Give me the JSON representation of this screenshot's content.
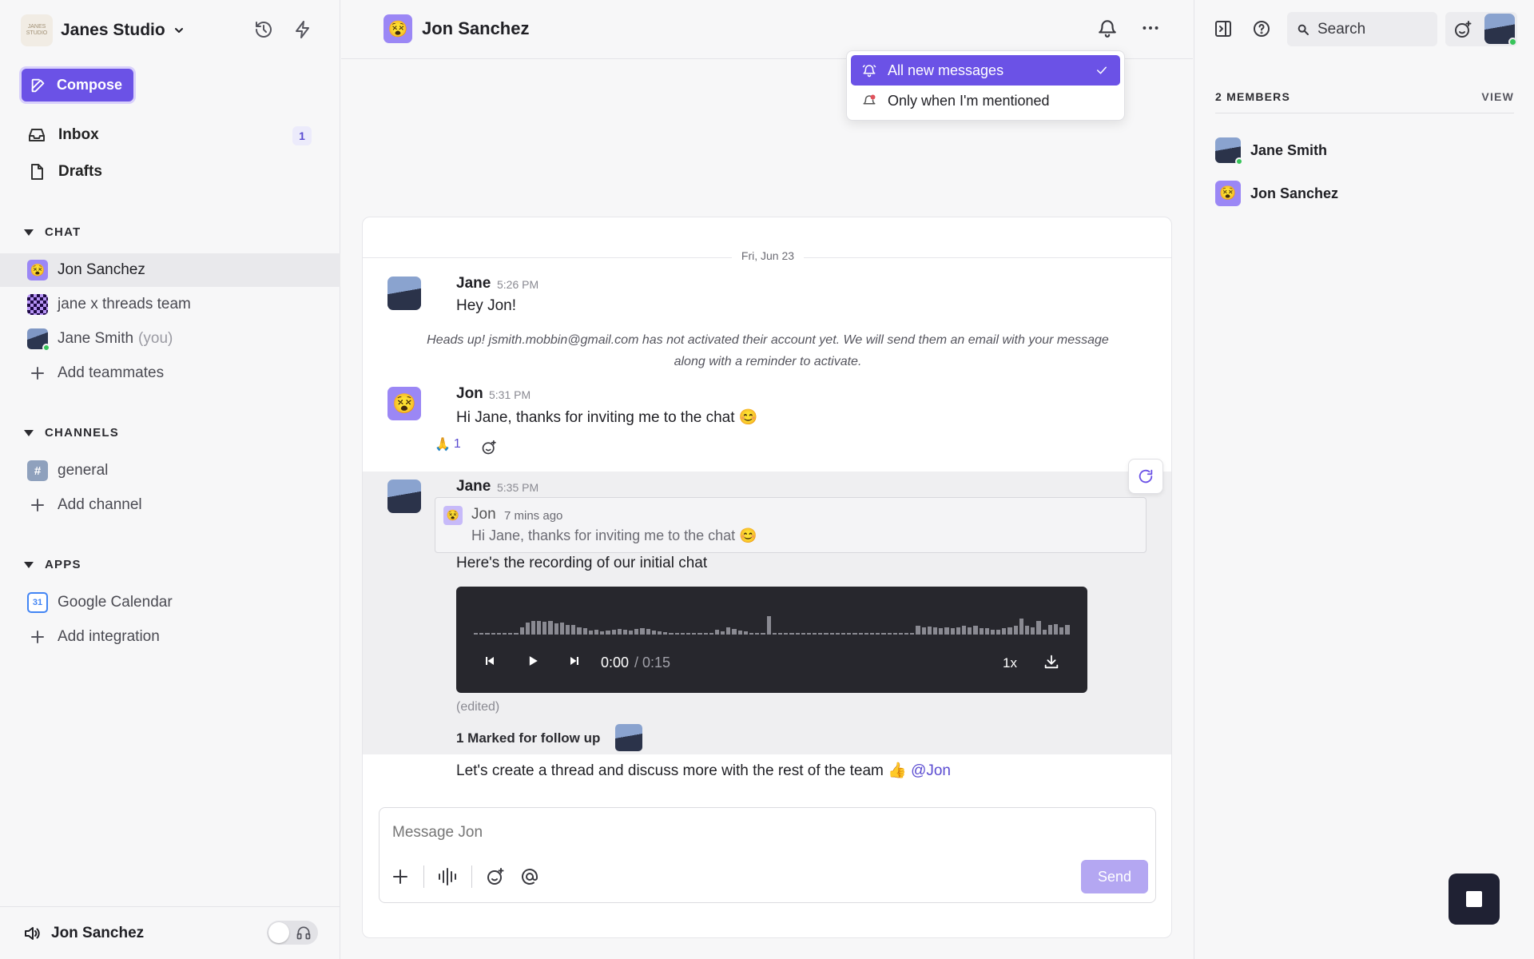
{
  "sidebar": {
    "workspace_name": "Janes Studio",
    "logo_text": "JANES STUDIO",
    "compose_label": "Compose",
    "inbox_label": "Inbox",
    "inbox_count": "1",
    "drafts_label": "Drafts",
    "chat_section": "CHAT",
    "chats": [
      {
        "label": "Jon Sanchez",
        "suffix": ""
      },
      {
        "label": "jane x threads team",
        "suffix": ""
      },
      {
        "label": "Jane Smith",
        "suffix": "(you)"
      }
    ],
    "add_teammates": "Add teammates",
    "channels_section": "CHANNELS",
    "channel_general": "general",
    "add_channel": "Add channel",
    "apps_section": "APPS",
    "app_calendar": "Google Calendar",
    "calendar_day": "31",
    "add_integration": "Add integration",
    "footer_user": "Jon Sanchez"
  },
  "header": {
    "title": "Jon Sanchez"
  },
  "notify_menu": {
    "items": [
      {
        "label": "All new messages",
        "selected": true
      },
      {
        "label": "Only when I'm mentioned",
        "selected": false
      }
    ]
  },
  "conversation": {
    "date": "Fri, Jun 23",
    "msg1": {
      "author": "Jane",
      "time": "5:26 PM",
      "text": "Hey Jon!"
    },
    "notice_line1": "Heads up! jsmith.mobbin@gmail.com has not activated their account yet. We will send them an email with your message",
    "notice_line2": "along with a reminder to activate.",
    "msg2": {
      "author": "Jon",
      "time": "5:31 PM",
      "text": "Hi Jane, thanks for inviting me to the chat 😊"
    },
    "reaction_emoji": "🙏",
    "reaction_count": "1",
    "msg3": {
      "author": "Jane",
      "time": "5:35 PM",
      "quote_author": "Jon",
      "quote_time": "7 mins ago",
      "quote_text": "Hi Jane, thanks for inviting me to the chat 😊",
      "text": "Here's the recording of our initial chat",
      "audio_current": "0:00",
      "audio_total": "/ 0:15",
      "audio_speed": "1x",
      "edited": "(edited)",
      "followup": "1 Marked for follow up"
    },
    "msg4": {
      "text": "Let's create a thread and discuss more with the rest of the team 👍",
      "mention": "@Jon"
    }
  },
  "composer": {
    "placeholder": "Message Jon",
    "send_label": "Send"
  },
  "right_panel": {
    "search_label": "Search",
    "members_title": "2 MEMBERS",
    "view_label": "VIEW",
    "members": [
      "Jane Smith",
      "Jon Sanchez"
    ]
  },
  "colors": {
    "accent": "#6b52e6",
    "online": "#37c45a",
    "audio_bg": "#27272d"
  }
}
